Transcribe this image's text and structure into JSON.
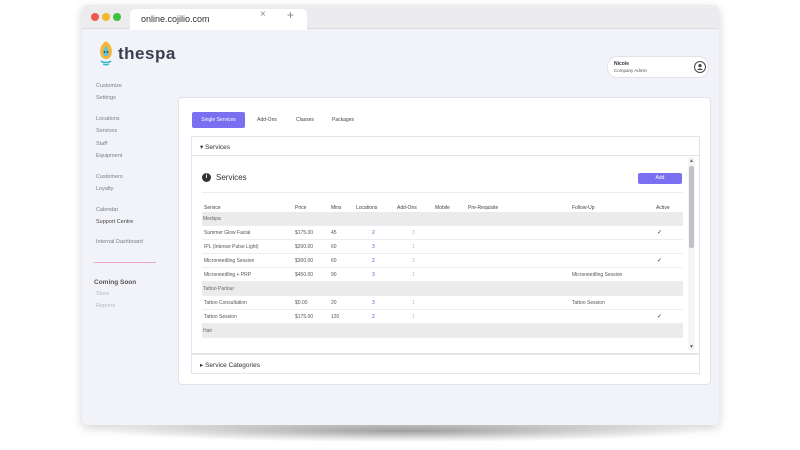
{
  "browser": {
    "tab_title": "online.cojilio.com",
    "close_glyph": "×",
    "new_tab_glyph": "+"
  },
  "brand": {
    "name": "thespa",
    "logo_icon": "lotus-icon"
  },
  "sidebar": {
    "items": [
      {
        "label": "Customize"
      },
      {
        "label": "Settings"
      },
      {
        "label": "Locations"
      },
      {
        "label": "Services"
      },
      {
        "label": "Staff"
      },
      {
        "label": "Equipment"
      },
      {
        "label": "Customers"
      },
      {
        "label": "Loyalty"
      },
      {
        "label": "Calendar"
      },
      {
        "label": "Support Centre"
      },
      {
        "label": "Internal Dashboard"
      }
    ],
    "coming_soon": "Coming Soon",
    "coming_soon_items": [
      {
        "label": "Store"
      },
      {
        "label": "Reports"
      }
    ]
  },
  "user": {
    "name": "Nicole",
    "role": "Company Admin",
    "icon": "user-icon"
  },
  "tabs": [
    {
      "label": "Single Services",
      "active": true
    },
    {
      "label": "Add-Ons",
      "active": false
    },
    {
      "label": "Classes",
      "active": false
    },
    {
      "label": "Packages",
      "active": false
    }
  ],
  "services_section": {
    "toggle_label": "Services",
    "title": "Services",
    "add_label": "Add",
    "columns": [
      "Service",
      "Price",
      "Mins",
      "Locations",
      "Add-Ons",
      "Mobile",
      "Pre-Requisite",
      "Follow-Up",
      "Active"
    ],
    "groups": [
      {
        "name": "Medspa",
        "rows": [
          {
            "service": "Summer Glow Facial",
            "price": "$175.00",
            "mins": "45",
            "locations": "2",
            "addons": "3",
            "mobile": "",
            "prereq": "",
            "followup": "",
            "active": "✓"
          },
          {
            "service": "IPL (Intense Pulse Light)",
            "price": "$200.00",
            "mins": "60",
            "locations": "3",
            "addons": "1",
            "mobile": "",
            "prereq": "",
            "followup": "",
            "active": ""
          },
          {
            "service": "Microneedling Session",
            "price": "$300.00",
            "mins": "60",
            "locations": "2",
            "addons": "3",
            "mobile": "",
            "prereq": "",
            "followup": "",
            "active": "✓"
          },
          {
            "service": "Microneedling + PRP",
            "price": "$450.00",
            "mins": "90",
            "locations": "3",
            "addons": "1",
            "mobile": "",
            "prereq": "",
            "followup": "Microneedling Session",
            "active": ""
          }
        ]
      },
      {
        "name": "Tattoo Parlour",
        "rows": [
          {
            "service": "Tattoo Consultation",
            "price": "$0.00",
            "mins": "20",
            "locations": "3",
            "addons": "1",
            "mobile": "",
            "prereq": "",
            "followup": "Tattoo Session",
            "active": ""
          },
          {
            "service": "Tattoo Session",
            "price": "$175.00",
            "mins": "120",
            "locations": "2",
            "addons": "1",
            "mobile": "",
            "prereq": "",
            "followup": "",
            "active": "✓"
          }
        ]
      },
      {
        "name": "Hair",
        "rows": []
      }
    ]
  },
  "categories_section": {
    "toggle_label": "Service Categories"
  },
  "colors": {
    "accent": "#7a6ff0",
    "link": "#4a5fd0"
  }
}
